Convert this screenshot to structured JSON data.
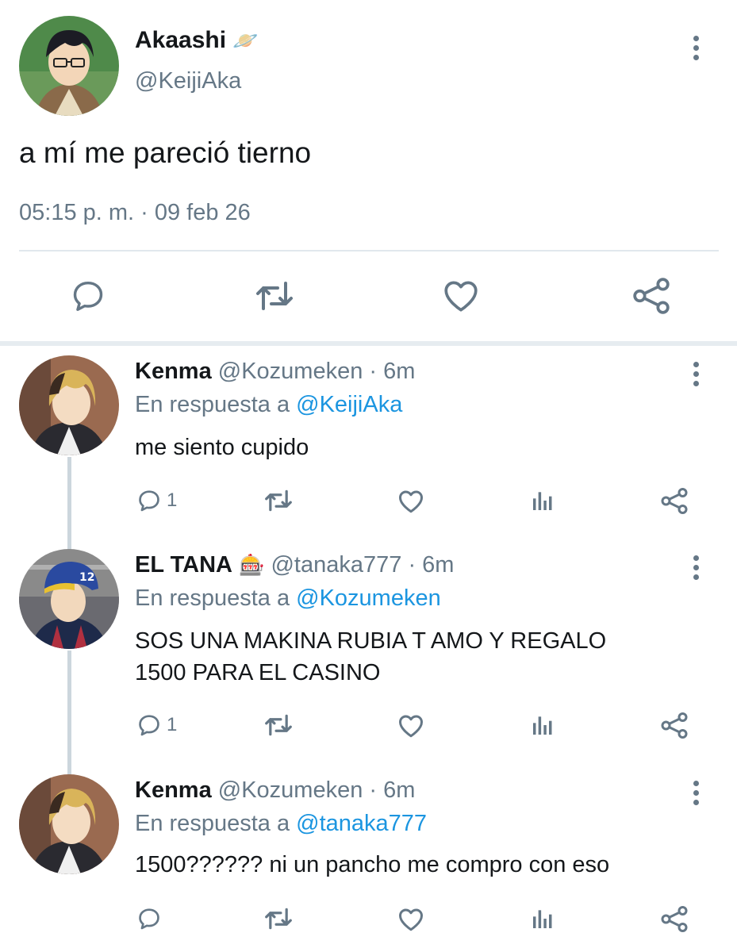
{
  "main_tweet": {
    "display_name": "Akaashi",
    "name_emoji": "🪐",
    "handle": "@KeijiAka",
    "text": "a mí me pareció tierno",
    "timestamp": "05:15 p. m. · 09 feb 26"
  },
  "replies": [
    {
      "display_name": "Kenma",
      "handle": "@Kozumeken",
      "time": "· 6m",
      "reply_prefix": "En respuesta a",
      "reply_to": "@KeijiAka",
      "text": "me siento cupido",
      "reply_count": "1"
    },
    {
      "display_name": "EL TANA",
      "name_emoji": "🎰",
      "handle": "@tanaka777",
      "time": "· 6m",
      "reply_prefix": "En respuesta a",
      "reply_to": "@Kozumeken",
      "text_line1": "SOS UNA MAKINA RUBIA T AMO Y REGALO",
      "text_line2": "1500 PARA EL CASINO",
      "reply_count": "1"
    },
    {
      "display_name": "Kenma",
      "handle": "@Kozumeken",
      "time": "· 6m",
      "reply_prefix": "En respuesta a",
      "reply_to": "@tanaka777",
      "text": "1500?????? ni un pancho me compro con eso",
      "reply_count": ""
    }
  ],
  "icons": [
    "reply-icon",
    "retweet-icon",
    "like-icon",
    "share-icon",
    "analytics-icon",
    "more-icon"
  ],
  "colors": {
    "text": "#14171a",
    "secondary": "#657786",
    "link": "#1b95e0",
    "divider": "#e1e8ed"
  }
}
